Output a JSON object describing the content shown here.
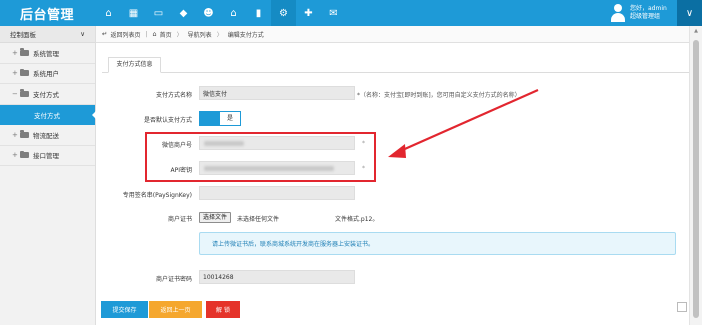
{
  "header": {
    "logo": "后台管理",
    "nav_icons": [
      "home-icon",
      "grid-icon",
      "monitor-icon",
      "tag-icon",
      "user-group-icon",
      "house-icon",
      "chart-icon",
      "gear-icon",
      "puzzle-icon",
      "chat-icon"
    ],
    "active_nav_index": 7,
    "user_line1": "您好，admin",
    "user_line2": "超级管理组",
    "toggle_glyph": "∨"
  },
  "sidebar": {
    "title": "控制面板",
    "title_glyph": "∨",
    "items": [
      {
        "label": "系统管理",
        "toggle": "+"
      },
      {
        "label": "系统用户",
        "toggle": "+"
      },
      {
        "label": "支付方式",
        "toggle": "−"
      },
      {
        "label": "物流配送",
        "toggle": "+"
      },
      {
        "label": "接口管理",
        "toggle": "+"
      }
    ],
    "sub_item": "支付方式"
  },
  "breadcrumb": {
    "back": "返回列表页",
    "home": "首页",
    "list": "导航列表",
    "current": "编辑支付方式",
    "sep": "〉"
  },
  "tab": {
    "label": "支付方式信息"
  },
  "form": {
    "name_label": "支付方式名称",
    "name_value": "微信支付",
    "name_hint": "*（名称：支付宝[即时到账]，您可用自定义支付方式的名称）",
    "default_label": "是否默认支付方式",
    "default_value": "是",
    "merchant_label": "微信商户号",
    "merchant_required": "*",
    "apikey_label": "API密钥",
    "apikey_required": "*",
    "sign_label": "专用签名串(PaySignKey)",
    "cert_label": "商户证书",
    "file_button": "选择文件",
    "file_status": "未选择任何文件",
    "file_format": "文件格式.p12。",
    "info_text": "请上传微证书后，联系商城系统开发商在服务器上安装证书。",
    "cert_pwd_label": "商户证书密码",
    "cert_pwd_value": "10014268"
  },
  "buttons": {
    "save": "提交保存",
    "back": "返回上一页",
    "unlock": "解 锁"
  },
  "colors": {
    "primary": "#1e9ad7",
    "highlight": "#e2262f",
    "back_button": "#f5a72e"
  }
}
